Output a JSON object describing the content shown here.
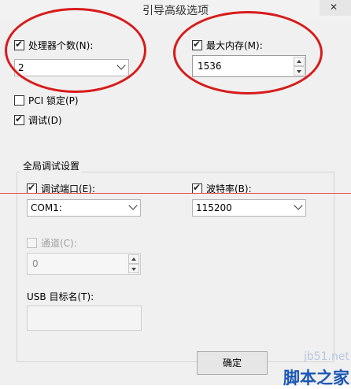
{
  "window": {
    "title": "引导高级选项"
  },
  "processors": {
    "label": "处理器个数(N):",
    "checked": true,
    "value": "2"
  },
  "memory": {
    "label": "最大内存(M):",
    "checked": true,
    "value": "1536"
  },
  "pci_lock": {
    "label": "PCI 锁定(P)",
    "checked": false
  },
  "debug": {
    "label": "调试(D)",
    "checked": true
  },
  "global_debug": {
    "title": "全局调试设置",
    "debug_port": {
      "label": "调试端口(E):",
      "checked": true,
      "value": "COM1:"
    },
    "baud_rate": {
      "label": "波特率(B):",
      "checked": true,
      "value": "115200"
    },
    "channel": {
      "label": "通道(C):",
      "checked": false,
      "enabled": false,
      "value": "0"
    },
    "usb_target": {
      "label": "USB 目标名(T):",
      "value": ""
    }
  },
  "buttons": {
    "ok": "确定"
  },
  "watermark": {
    "line1": "jb51.net",
    "line2": "脚本之家"
  },
  "colors": {
    "annotation_red": "#d81b1b",
    "dialog_bg": "#f0f0f0"
  }
}
